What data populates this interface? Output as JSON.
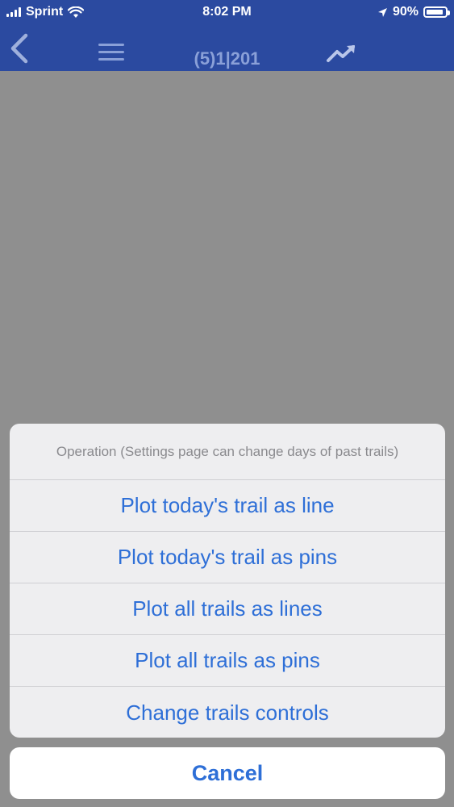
{
  "status": {
    "carrier": "Sprint",
    "time": "8:02 PM",
    "battery": "90%",
    "battery_level": 0.9,
    "icons": [
      "signal-icon",
      "wifi-icon",
      "location-arrow-icon",
      "battery-icon"
    ]
  },
  "nav": {
    "title": "(5)1|201",
    "icons": [
      "back-chevron-icon",
      "hamburger-menu-icon",
      "trending-up-icon"
    ]
  },
  "action_sheet": {
    "header": "Operation (Settings page can change days of past trails)",
    "items": [
      {
        "label": "Plot today's trail as line"
      },
      {
        "label": "Plot today's trail as pins"
      },
      {
        "label": "Plot all trails as lines"
      },
      {
        "label": "Plot all trails as pins"
      },
      {
        "label": "Change trails controls"
      }
    ],
    "cancel_label": "Cancel"
  },
  "colors": {
    "nav_background": "#2b4aa0",
    "page_overlay": "#8f8f8f",
    "sheet_background": "#eeeef0",
    "action_blue": "#2e6fd7",
    "header_gray": "#8a8a8e"
  }
}
